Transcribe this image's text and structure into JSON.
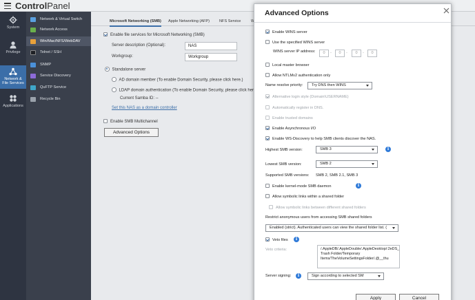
{
  "app": {
    "title_bold": "Control",
    "title_rest": "Panel"
  },
  "rail": [
    {
      "label": "System"
    },
    {
      "label": "Privilege"
    },
    {
      "label": "Network &\nFile Services"
    },
    {
      "label": "Applications"
    }
  ],
  "subnav": [
    "Network & Virtual Switch",
    "Network Access",
    "Win/Mac/NFS/WebDAV",
    "Telnet / SSH",
    "SNMP",
    "Service Discovery",
    "QuFTP Service",
    "Recycle Bin"
  ],
  "tabs": [
    "Microsoft Networking (SMB)",
    "Apple Networking (AFP)",
    "NFS Service",
    "W"
  ],
  "smb": {
    "enable_label": "Enable file services for Microsoft Networking (SMB)",
    "server_desc_label": "Server description (Optional):",
    "server_desc_value": "NAS",
    "workgroup_label": "Workgroup:",
    "workgroup_value": "Workgroup",
    "standalone_label": "Standalone server",
    "ad_label": "AD domain member (To enable Domain Security, please click here.)",
    "ldap_label": "LDAP domain authentication (To enable Domain Security, please click here.",
    "samba_id_label": "Current Samba ID: --",
    "domain_controller_link": "Set this NAS as a domain controller",
    "multichannel_label": "Enable SMB Multichannel",
    "advanced_button": "Advanced Options"
  },
  "dialog": {
    "title": "Advanced Options",
    "wins_enable": "Enable WINS server",
    "wins_specified": "Use the specified WINS server",
    "wins_ip_label": "WINS server IP address:",
    "wins_ip": [
      "0",
      "0",
      "0",
      "0"
    ],
    "local_master": "Local master browser",
    "ntlmv2": "Allow NTLMv2 authentication only",
    "name_resolve_label": "Name resolve priority:",
    "name_resolve_value": "Try DNS then WINS",
    "alt_login": "Alternative login style (Domain\\USERNAME)",
    "auto_register": "Automatically register in DNS.",
    "trusted_domains": "Enable trusted domains",
    "async_io": "Enable Asynchronous I/O",
    "ws_discovery": "Enable WS-Discovery to help SMB clients discover the NAS.",
    "highest_label": "Highest SMB version:",
    "highest_value": "SMB 3",
    "lowest_label": "Lowest SMB version:",
    "lowest_value": "SMB 2",
    "supported_label": "Supported SMB versions:",
    "supported_value": "SMB 2, SMB 2.1, SMB 3",
    "kernel_mode": "Enable kernel-mode SMB daemon",
    "symlinks": "Allow symbolic links within a shared folder",
    "symlinks_between": "Allow symbolic links between different shared folders",
    "restrict_label": "Restrict anonymous users from accessing SMB shared folders",
    "restrict_value": "Enabled (strict). Authenticated users can view the shared folder list. (",
    "veto_files": "Veto files",
    "veto_criteria_label": "Veto criteria:",
    "veto_criteria_value": "/.AppleDB/.AppleDouble/.AppleDesktop/:2eDS_Store/Network Trash Folder/Temporary Items/TheVolumeSettingsFolder/.@__thu",
    "signing_label": "Server signing:",
    "signing_value": "Sign according to selected SM",
    "apply_button": "Apply",
    "cancel_button": "Cancel"
  },
  "colors": {
    "accent": "#3b6ea8",
    "info": "#2f7ad8",
    "rail_bg": "#2e3441",
    "subnav_bg": "#3a404c"
  }
}
